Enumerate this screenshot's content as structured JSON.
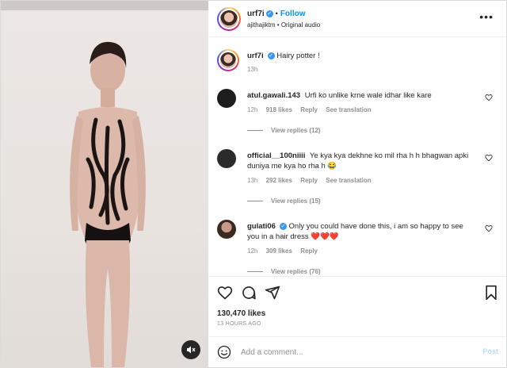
{
  "post": {
    "username": "urf7i",
    "follow_label": "Follow",
    "audio_line": "ajithajiktm • Original audio",
    "more_label": "•••"
  },
  "caption": {
    "username": "urf7i",
    "text": "Hairy potter !",
    "time": "13h"
  },
  "comments": [
    {
      "username": "atul.gawali.143",
      "text": "Urfi ko unlike krne wale idhar like kare",
      "time": "12h",
      "likes": "918 likes",
      "reply": "Reply",
      "translate": "See translation",
      "view_replies": "View replies (12)"
    },
    {
      "username": "official__100niiii",
      "text": "Ye kya kya dekhne ko mil rha h h bhagwan apki duniya me kya ho rha h 😂",
      "time": "13h",
      "likes": "292 likes",
      "reply": "Reply",
      "translate": "See translation",
      "view_replies": "View replies (15)"
    },
    {
      "username": "gulati06",
      "text": "Only you could have done this, i am so happy to see you in a hair dress ❤️❤️❤️",
      "time": "12h",
      "likes": "309 likes",
      "reply": "Reply",
      "view_replies": "View replies (76)"
    }
  ],
  "stats": {
    "likes": "130,470 likes",
    "ago": "13 HOURS AGO"
  },
  "add_comment": {
    "placeholder": "Add a comment...",
    "post_label": "Post"
  },
  "colors": {
    "accent": "#0095f6",
    "verified": "#3897f0",
    "muted_text": "#8e8e8e",
    "post_disabled": "#b2dffc"
  },
  "icons": {
    "mute": "speaker-muted-icon",
    "like": "heart-icon",
    "comment": "comment-icon",
    "share": "paper-plane-icon",
    "save": "bookmark-icon",
    "emoji": "smiley-icon",
    "more": "more-options-icon"
  }
}
